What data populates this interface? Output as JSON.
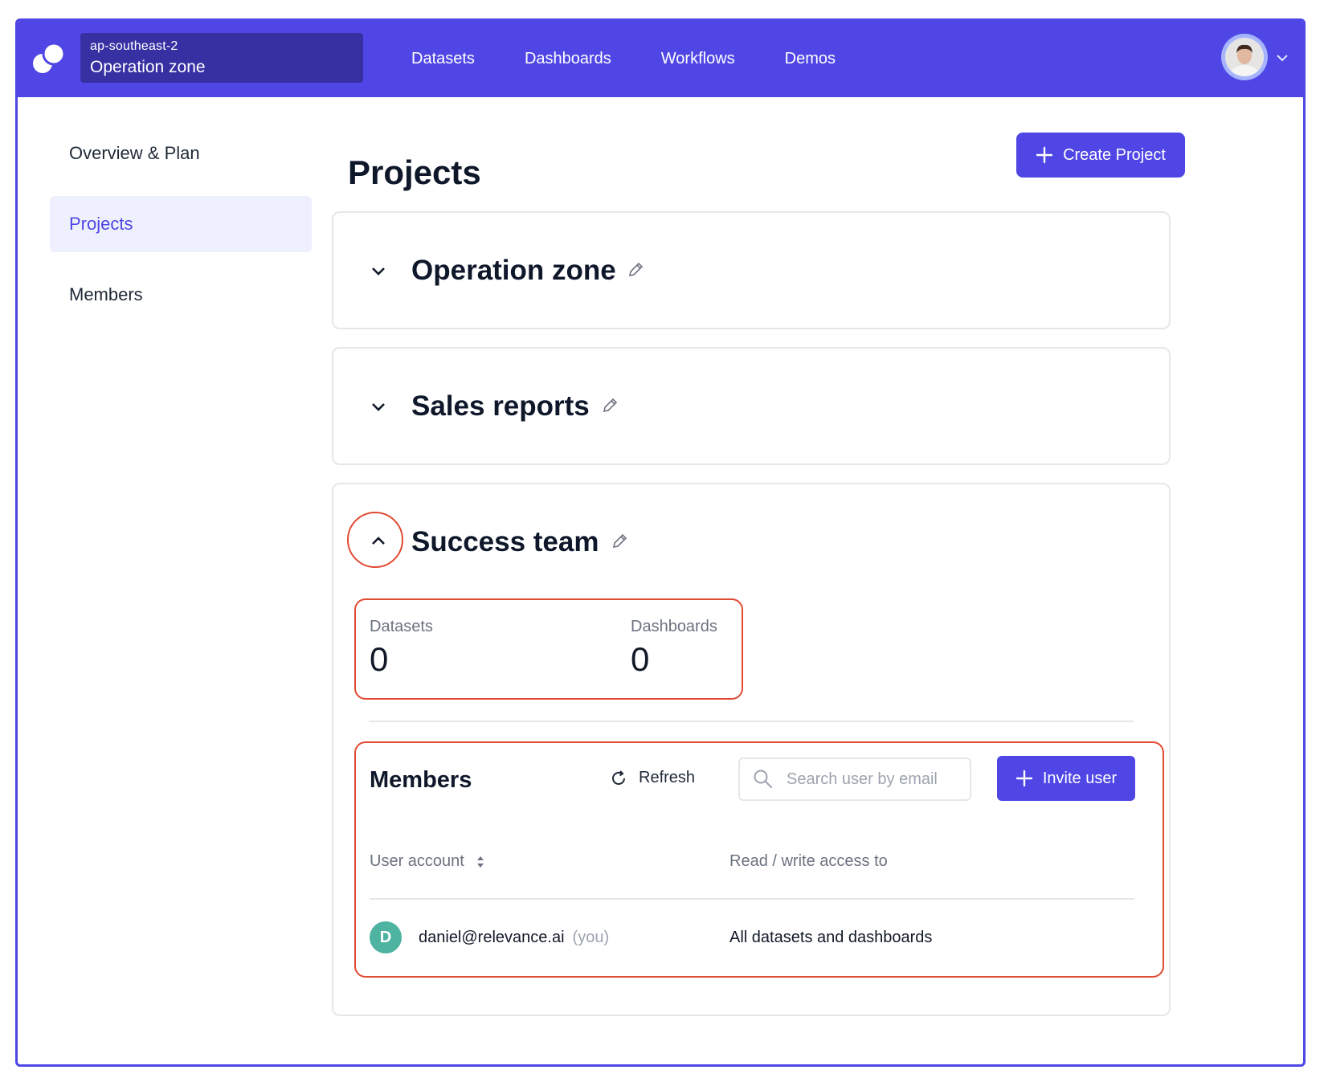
{
  "topbar": {
    "region": "ap-southeast-2",
    "zone_name": "Operation zone",
    "nav": [
      "Datasets",
      "Dashboards",
      "Workflows",
      "Demos"
    ],
    "brand_color": "#4f46e5"
  },
  "sidebar": {
    "items": [
      {
        "label": "Overview & Plan",
        "active": false
      },
      {
        "label": "Projects",
        "active": true
      },
      {
        "label": "Members",
        "active": false
      }
    ]
  },
  "main": {
    "title": "Projects",
    "create_label": "Create Project",
    "projects": [
      {
        "name": "Operation zone",
        "expanded": false
      },
      {
        "name": "Sales reports",
        "expanded": false
      },
      {
        "name": "Success team",
        "expanded": true
      }
    ],
    "stats": {
      "datasets_label": "Datasets",
      "datasets_value": "0",
      "dashboards_label": "Dashboards",
      "dashboards_value": "0"
    },
    "members": {
      "title": "Members",
      "refresh_label": "Refresh",
      "search_placeholder": "Search user by email",
      "invite_label": "Invite user",
      "col_user": "User account",
      "col_access": "Read / write access to",
      "rows": [
        {
          "initial": "D",
          "email": "daniel@relevance.ai",
          "you": "(you)",
          "access": "All datasets and dashboards"
        }
      ]
    }
  },
  "annotation_color": "#e14a33",
  "icons": [
    "logo-icon",
    "chevron-down-icon",
    "chevron-up-icon",
    "pencil-icon",
    "plus-icon",
    "refresh-icon",
    "search-icon",
    "sort-icon"
  ]
}
